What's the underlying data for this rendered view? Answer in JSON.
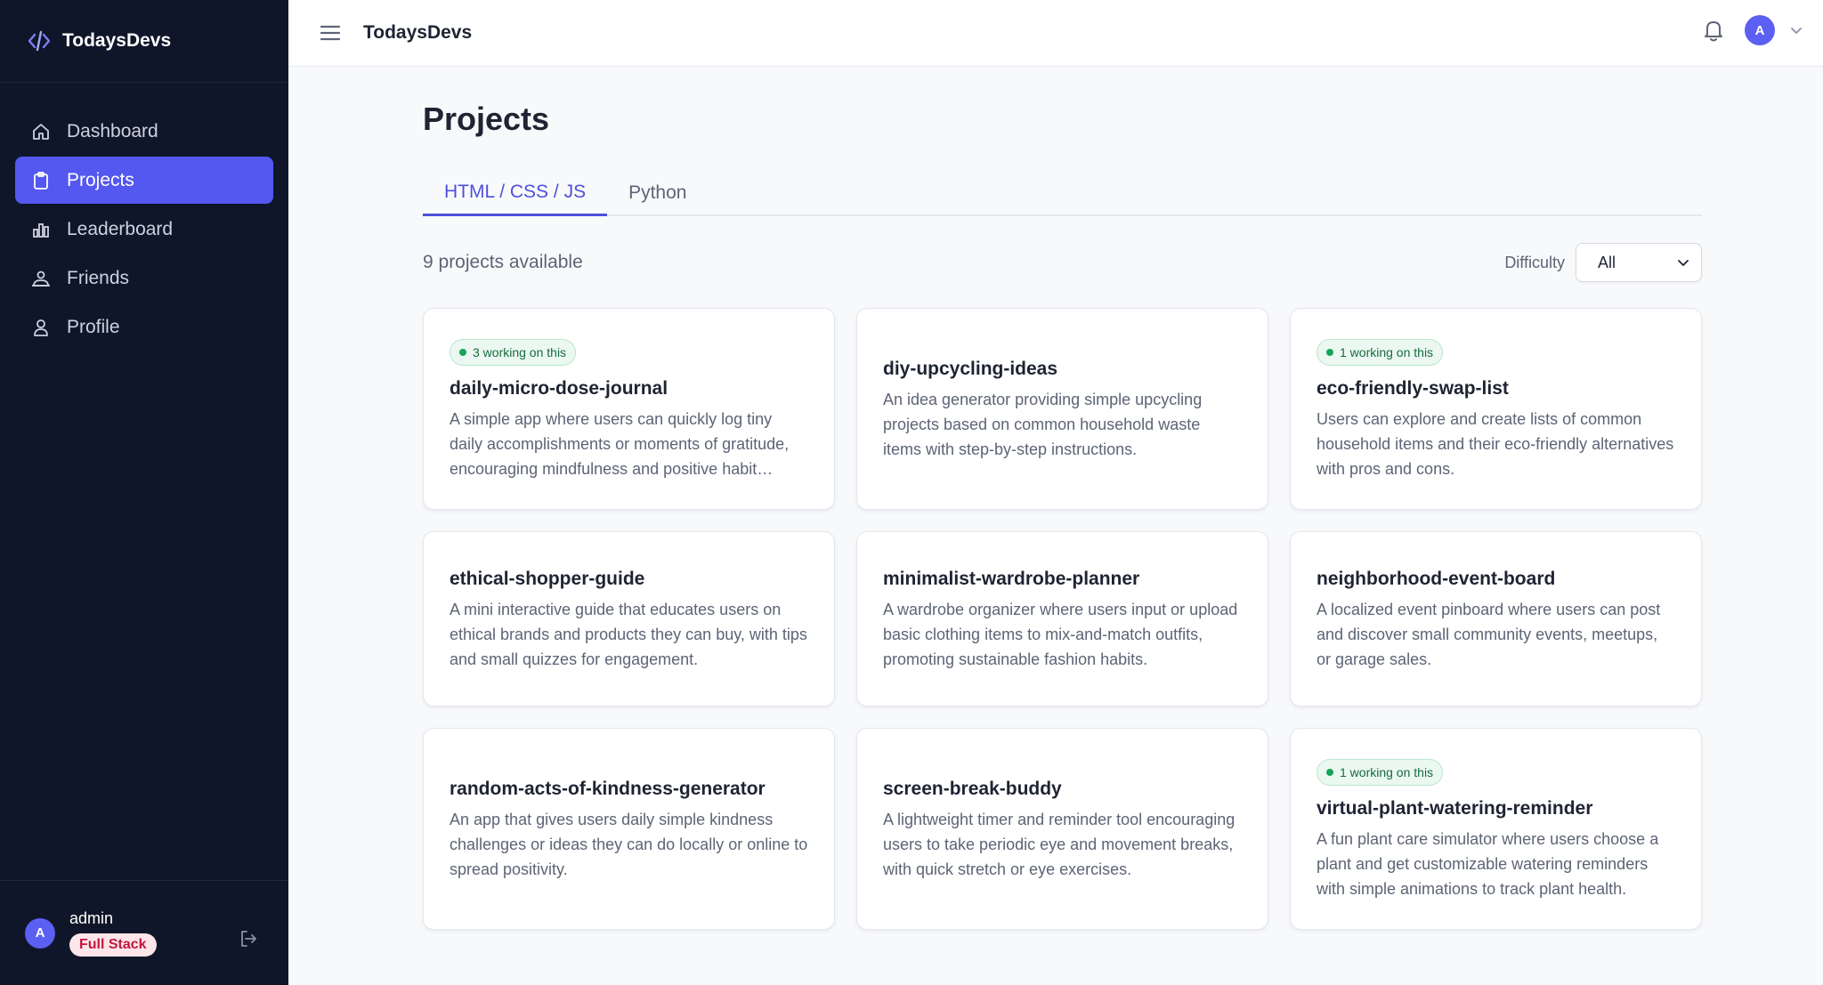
{
  "app": {
    "brand": "TodaysDevs",
    "accent_color": "#5457f0",
    "sidebar_bg": "#0f1629"
  },
  "sidebar": {
    "items": [
      {
        "label": "Dashboard",
        "icon": "home-icon"
      },
      {
        "label": "Projects",
        "icon": "clipboard-icon",
        "active": true
      },
      {
        "label": "Leaderboard",
        "icon": "bar-chart-icon"
      },
      {
        "label": "Friends",
        "icon": "users-icon"
      },
      {
        "label": "Profile",
        "icon": "user-icon"
      }
    ],
    "user": {
      "avatar_initial": "A",
      "name": "admin",
      "role": "Full Stack"
    }
  },
  "topbar": {
    "title": "TodaysDevs",
    "avatar_initial": "A"
  },
  "main": {
    "title": "Projects",
    "tabs": [
      {
        "label": "HTML / CSS / JS",
        "active": true
      },
      {
        "label": "Python",
        "active": false
      }
    ],
    "count_text": "9 projects available",
    "filter": {
      "label": "Difficulty",
      "selected": "All"
    },
    "projects": [
      {
        "badge": "3 working on this",
        "title": "daily-micro-dose-journal",
        "description": "A simple app where users can quickly log tiny daily accomplishments or moments of gratitude, encouraging mindfulness and positive habit formation."
      },
      {
        "badge": "",
        "title": "diy-upcycling-ideas",
        "description": "An idea generator providing simple upcycling projects based on common household waste items with step-by-step instructions."
      },
      {
        "badge": "1 working on this",
        "title": "eco-friendly-swap-list",
        "description": "Users can explore and create lists of common household items and their eco-friendly alternatives with pros and cons."
      },
      {
        "badge": "",
        "title": "ethical-shopper-guide",
        "description": "A mini interactive guide that educates users on ethical brands and products they can buy, with tips and small quizzes for engagement."
      },
      {
        "badge": "",
        "title": "minimalist-wardrobe-planner",
        "description": "A wardrobe organizer where users input or upload basic clothing items to mix-and-match outfits, promoting sustainable fashion habits."
      },
      {
        "badge": "",
        "title": "neighborhood-event-board",
        "description": "A localized event pinboard where users can post and discover small community events, meetups, or garage sales."
      },
      {
        "badge": "",
        "title": "random-acts-of-kindness-generator",
        "description": "An app that gives users daily simple kindness challenges or ideas they can do locally or online to spread positivity."
      },
      {
        "badge": "",
        "title": "screen-break-buddy",
        "description": "A lightweight timer and reminder tool encouraging users to take periodic eye and movement breaks, with quick stretch or eye exercises."
      },
      {
        "badge": "1 working on this",
        "title": "virtual-plant-watering-reminder",
        "description": "A fun plant care simulator where users choose a plant and get customizable watering reminders with simple animations to track plant health."
      }
    ]
  }
}
